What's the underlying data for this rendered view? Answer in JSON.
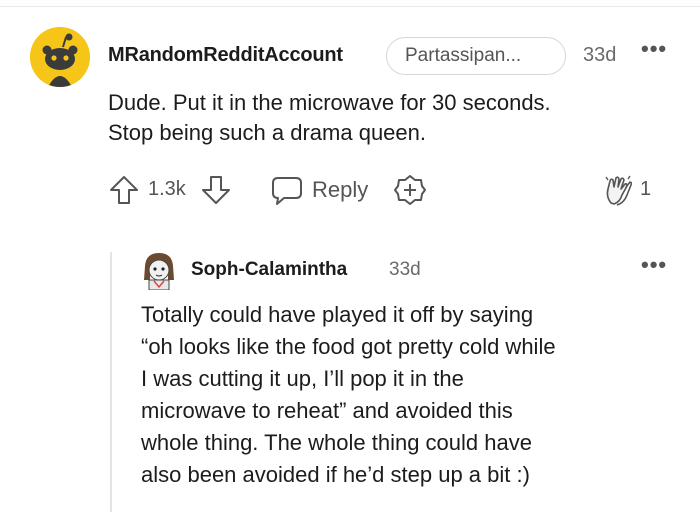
{
  "comment": {
    "username": "MRandomRedditAccount",
    "flair": "Partassipan...",
    "time": "33d",
    "body_lines": [
      "Dude. Put it in the microwave for 30 seconds.",
      "Stop being such a drama queen."
    ],
    "score": "1.3k",
    "reply_label": "Reply",
    "award_count": "1"
  },
  "reply": {
    "username": "Soph-Calamintha",
    "time": "33d",
    "body_lines": [
      "Totally could have played it off by saying",
      "“oh looks like the food got pretty cold while",
      "I was cutting it up, I’ll pop it in the",
      "microwave to reheat” and avoided this",
      "whole thing. The whole thing could have",
      "also been avoided if he’d step up a bit :)"
    ]
  },
  "colors": {
    "avatar_bg": "#f5c518",
    "text": "#1c1c1c",
    "muted": "#555555"
  },
  "icons": {
    "more": "more-options-icon",
    "upvote": "upvote-arrow-icon",
    "downvote": "downvote-arrow-icon",
    "reply": "reply-bubble-icon",
    "award": "add-award-icon",
    "clap": "clapping-hands-award-icon"
  }
}
